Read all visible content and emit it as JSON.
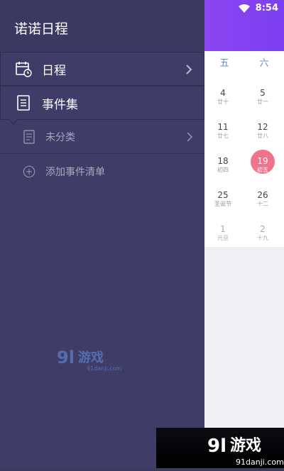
{
  "status_bar": {
    "time": "8:54",
    "wifi_icon": "wifi-icon"
  },
  "drawer": {
    "title": "诺诺日程",
    "items": [
      {
        "label": "日程",
        "icon": "calendar-clock-icon"
      },
      {
        "label": "事件集",
        "icon": "notebook-icon"
      }
    ],
    "sub_items": [
      {
        "label": "未分类",
        "icon": "document-icon"
      },
      {
        "label": "添加事件清单",
        "icon": "plus-circle-icon"
      }
    ]
  },
  "calendar": {
    "weekdays": [
      "五",
      "六"
    ],
    "rows": [
      [
        {
          "num": "4",
          "lunar": "廿十"
        },
        {
          "num": "5",
          "lunar": "廿一"
        }
      ],
      [
        {
          "num": "11",
          "lunar": "廿七"
        },
        {
          "num": "12",
          "lunar": "廿八"
        }
      ],
      [
        {
          "num": "18",
          "lunar": "初四"
        },
        {
          "num": "19",
          "lunar": "初五"
        }
      ],
      [
        {
          "num": "25",
          "lunar": "圣诞节"
        },
        {
          "num": "26",
          "lunar": "十二"
        }
      ],
      [
        {
          "num": "1",
          "lunar": "元旦"
        },
        {
          "num": "2",
          "lunar": "十九"
        }
      ]
    ],
    "colors": {
      "accent": "#7b3ff0",
      "today": "#f0728b",
      "weekday": "#5b8fcf"
    }
  },
  "watermark": {
    "text": "91游戏",
    "sub": "91danji.com"
  }
}
